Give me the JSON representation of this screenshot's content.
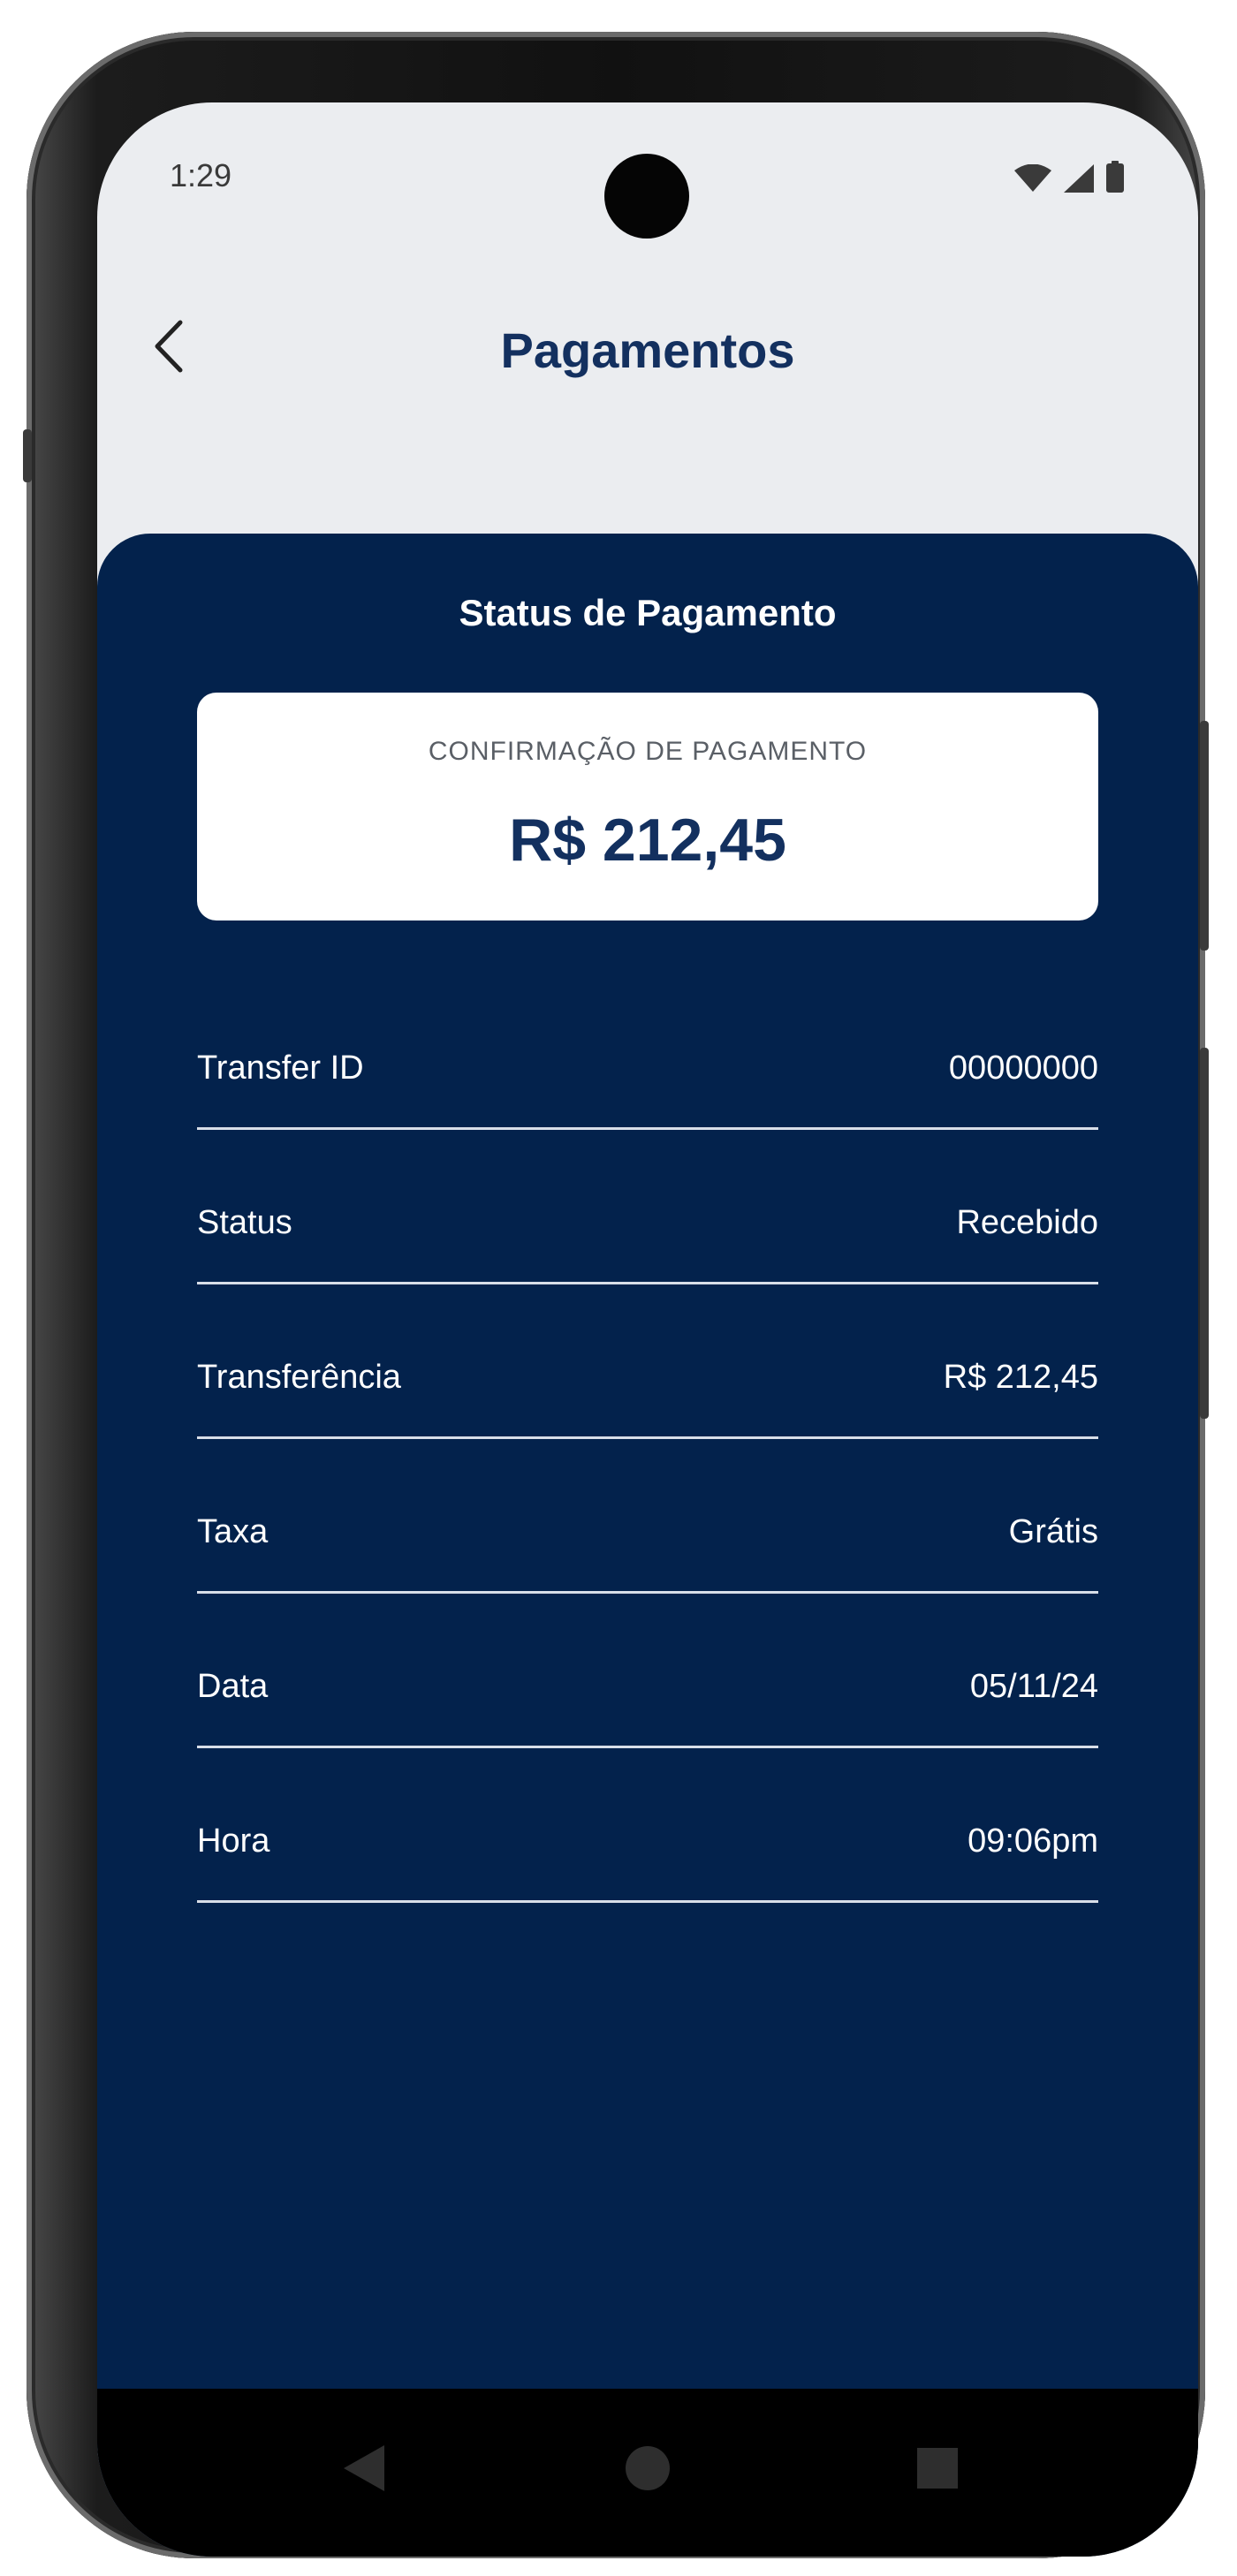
{
  "status_bar": {
    "time": "1:29",
    "icons": [
      "wifi-icon",
      "signal-icon",
      "battery-icon"
    ]
  },
  "header": {
    "title": "Pagamentos",
    "back_icon": "chevron-left-icon"
  },
  "panel": {
    "title": "Status de Pagamento",
    "confirmation": {
      "label": "CONFIRMAÇÃO DE PAGAMENTO",
      "amount": "R$ 212,45"
    },
    "details": [
      {
        "label": "Transfer ID",
        "value": "00000000"
      },
      {
        "label": "Status",
        "value": "Recebido"
      },
      {
        "label": "Transferência",
        "value": "R$ 212,45"
      },
      {
        "label": "Taxa",
        "value": "Grátis"
      },
      {
        "label": "Data",
        "value": "05/11/24"
      },
      {
        "label": "Hora",
        "value": "09:06pm"
      }
    ]
  },
  "nav_bar": {
    "buttons": [
      "back-triangle-icon",
      "home-circle-icon",
      "recents-square-icon"
    ]
  },
  "colors": {
    "panel_bg": "#03224c",
    "title_color": "#13305f",
    "screen_bg": "#ebedf0",
    "divider": "#d8dee8"
  }
}
